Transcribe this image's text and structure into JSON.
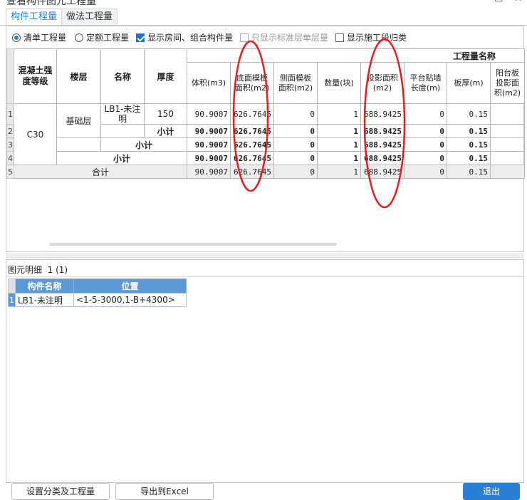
{
  "window": {
    "title": "查看构件图元工程量"
  },
  "tabs": [
    {
      "label": "构件工程量",
      "active": true
    },
    {
      "label": "做法工程量",
      "active": false
    }
  ],
  "options": {
    "radio_list": "清单工程量",
    "radio_quota": "定额工程量",
    "chk_show_room": "显示房间、组合构件量",
    "chk_std_floor": "只显示标准层单层量",
    "chk_stage": "显示施工段归类"
  },
  "table": {
    "group_header": "工程量名称",
    "headers": {
      "grade": "混凝土强度等级",
      "floor": "楼层",
      "name": "名称",
      "thick": "厚度",
      "vol": "体积(m3)",
      "bottom": "底面模板面积(m2)",
      "side": "侧面模板面积(m2)",
      "count": "数量(块)",
      "proj": "投影面积(m2)",
      "platform": "平台贴墙长度(m)",
      "slab": "板厚(m)",
      "balcony": "阳台板投影面积(m2)"
    },
    "row_numbers": [
      "1",
      "2",
      "3",
      "4",
      "5"
    ],
    "grade": "C30",
    "floor": "基础层",
    "name": "LB1-未注明",
    "thick": "150",
    "subtotal": "小计",
    "total": "合计",
    "rows": [
      [
        "90.9007",
        "626.7645",
        "0",
        "1",
        "688.9425",
        "0",
        "0.15"
      ],
      [
        "90.9007",
        "626.7645",
        "0",
        "1",
        "688.9425",
        "0",
        "0.15"
      ],
      [
        "90.9007",
        "626.7645",
        "0",
        "1",
        "688.9425",
        "0",
        "0.15"
      ],
      [
        "90.9007",
        "626.7645",
        "0",
        "1",
        "688.9425",
        "0",
        "0.15"
      ],
      [
        "90.9007",
        "626.7645",
        "0",
        "1",
        "688.9425",
        "0",
        "0.15"
      ]
    ]
  },
  "detail": {
    "title": "图元明细",
    "count": "1 (1)",
    "headers": {
      "name": "构件名称",
      "position": "位置"
    },
    "rows": [
      {
        "num": "1",
        "name": "LB1-未注明",
        "position": "<1-5-3000,1-B+4300>"
      }
    ]
  },
  "buttons": {
    "settings": "设置分类及工程量",
    "export": "导出到Excel",
    "exit": "退出"
  },
  "colors": {
    "accent": "#2a7fd6",
    "annotation": "#e02020"
  }
}
